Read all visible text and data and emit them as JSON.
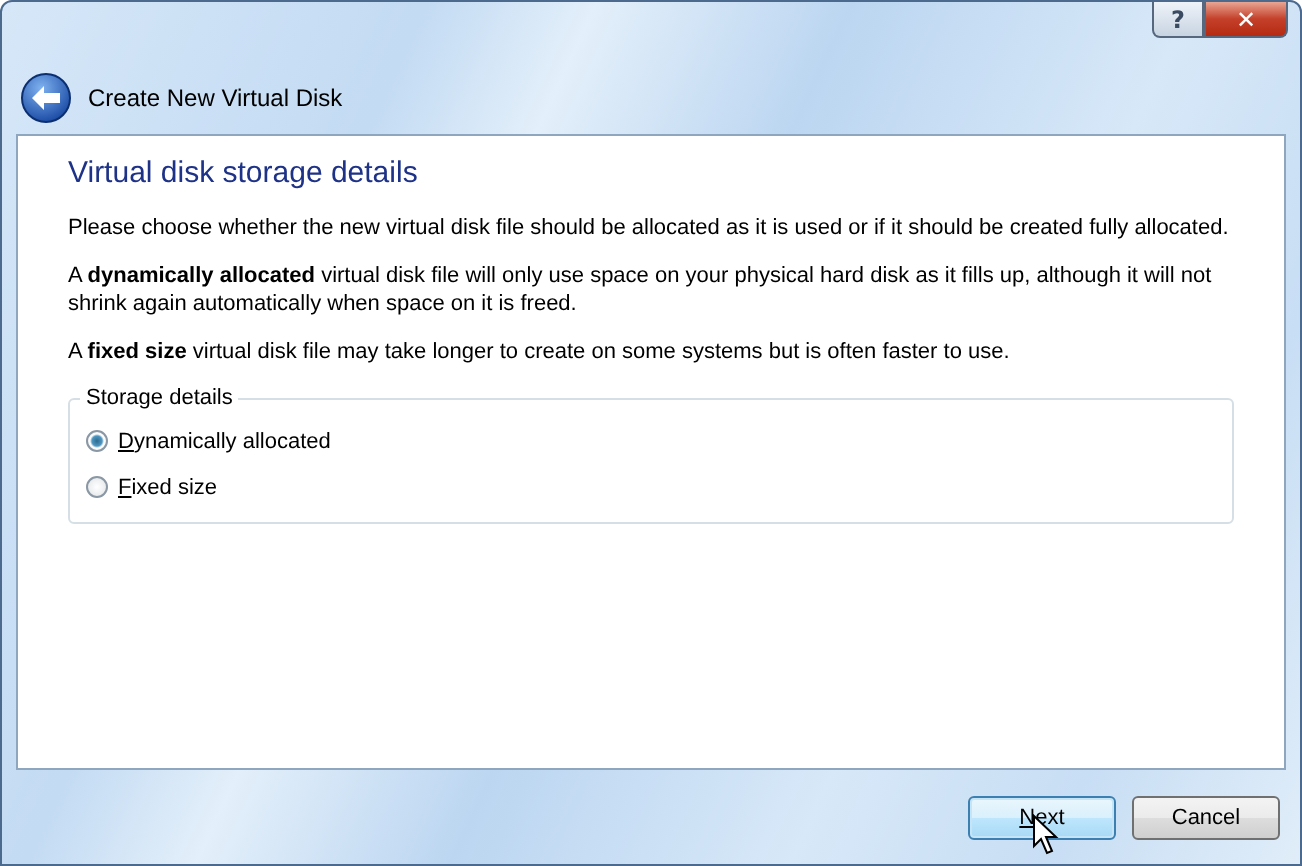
{
  "window": {
    "title_buttons": [
      {
        "kind": "help",
        "label": "?"
      },
      {
        "kind": "close",
        "label": "✕"
      }
    ]
  },
  "header": {
    "title": "Create New Virtual Disk"
  },
  "page": {
    "heading": "Virtual disk storage details",
    "paragraphs": [
      "Please choose whether the new virtual disk file should be allocated as it is used or if it should be created fully allocated.",
      "A **dynamically allocated** virtual disk file will only use space on your physical hard disk as it fills up, although it will not shrink again automatically when space on it is freed.",
      "A **fixed size** virtual disk file may take longer to create on some systems but is often faster to use."
    ],
    "group": {
      "title": "Storage details",
      "options": [
        {
          "label": "Dynamically allocated",
          "selected": true,
          "mnemonic": true
        },
        {
          "label": "Fixed size",
          "selected": false,
          "mnemonic": true
        }
      ]
    }
  },
  "buttons": [
    {
      "label": "Next",
      "default": true,
      "mnemonic": true,
      "hovered": true
    },
    {
      "label": "Cancel",
      "default": false,
      "mnemonic": false,
      "hovered": false
    }
  ]
}
